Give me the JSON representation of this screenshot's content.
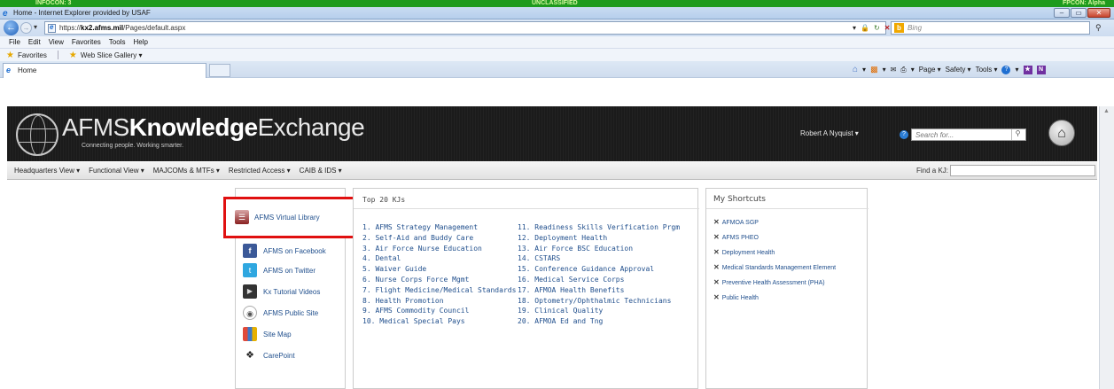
{
  "classification": {
    "left": "INFOCON: 3",
    "center": "UNCLASSIFIED",
    "right": "FPCON: Alpha"
  },
  "window": {
    "title": "Home - Internet Explorer provided by USAF",
    "buttons": [
      "–",
      "▭",
      "✕"
    ]
  },
  "address": {
    "url_prefix": "https://",
    "url_host": "kx2.afms.mil",
    "url_path": "/Pages/default.aspx"
  },
  "search": {
    "placeholder": "Bing",
    "logo": "b"
  },
  "menu": [
    "File",
    "Edit",
    "View",
    "Favorites",
    "Tools",
    "Help"
  ],
  "favorites": {
    "label": "Favorites",
    "web_slice": "Web Slice Gallery ▾"
  },
  "tab": {
    "label": "Home"
  },
  "commandbar": {
    "page": "Page ▾",
    "safety": "Safety ▾",
    "tools": "Tools ▾"
  },
  "site": {
    "logo_prefix": "AFMS",
    "logo_bold": "Knowledge",
    "logo_suffix": "Exchange",
    "tagline": "Connecting people. Working smarter.",
    "user": "Robert A Nyquist ▾",
    "search_placeholder": "Search for..."
  },
  "site_nav": {
    "items": [
      "Headquarters View ▾",
      "Functional View ▾",
      "MAJCOMs & MTFs ▾",
      "Restricted Access ▾",
      "CAIB & IDS ▾"
    ],
    "find_label": "Find a KJ:"
  },
  "links": [
    {
      "label": "AFMS Virtual Library",
      "icon": "book-icon"
    },
    {
      "label": "AFMS on Facebook",
      "icon": "facebook-icon"
    },
    {
      "label": "AFMS on Twitter",
      "icon": "twitter-icon"
    },
    {
      "label": "Kx Tutorial Videos",
      "icon": "video-icon"
    },
    {
      "label": "AFMS Public Site",
      "icon": "public-site-icon"
    },
    {
      "label": "Site Map",
      "icon": "sitemap-icon"
    },
    {
      "label": "CarePoint",
      "icon": "carepoint-icon"
    }
  ],
  "top20": {
    "title": "Top 20 KJs",
    "col1": [
      "1. AFMS Strategy Management",
      "2. Self-Aid and Buddy Care",
      "3. Air Force Nurse Education",
      "4. Dental",
      "5. Waiver Guide",
      "6. Nurse Corps Force Mgmt",
      "7. Flight Medicine/Medical Standards",
      "8. Health Promotion",
      "9. AFMS Commodity Council",
      "10. Medical Special Pays"
    ],
    "col2": [
      "11. Readiness Skills Verification Prgm",
      "12. Deployment Health",
      "13. Air Force BSC Education",
      "14. CSTARS",
      "15. Conference Guidance Approval",
      "16. Medical Service Corps",
      "17. AFMOA Health Benefits",
      "18. Optometry/Ophthalmic Technicians",
      "19. Clinical Quality",
      "20. AFMOA Ed and Tng"
    ]
  },
  "shortcuts": {
    "title": "My Shortcuts",
    "items": [
      "AFMOA SGP",
      "AFMS PHEO",
      "Deployment Health",
      "Medical Standards Management Element",
      "Preventive Health Assessment (PHA)",
      "Public Health"
    ]
  },
  "colors": {
    "classification": "#1e9b1e",
    "highlight": "#e01010",
    "header": "#1b1b1b",
    "link": "#1f4e8c"
  }
}
